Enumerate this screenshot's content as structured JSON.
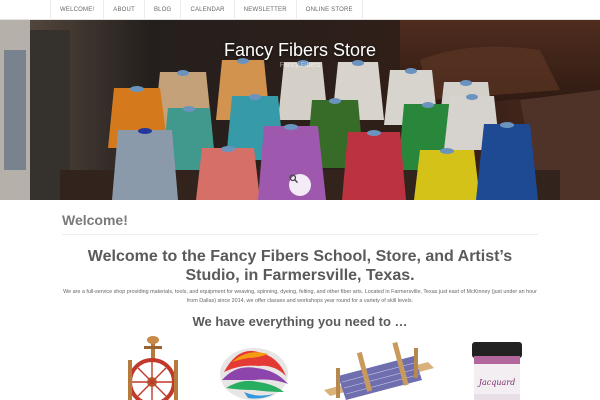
{
  "nav": {
    "items": [
      "WELCOME!",
      "ABOUT",
      "BLOG",
      "CALENDAR",
      "NEWSLETTER",
      "ONLINE STORE"
    ]
  },
  "hero": {
    "title": "Fancy Fibers Store",
    "tagline": "Fancy Fibers"
  },
  "main": {
    "page_title": "Welcome!",
    "heading": "Welcome to the  Fancy Fibers School, Store, and Artist’s Studio, in Farmersville, Texas.",
    "intro": "We are a full-service shop providing materials, tools, and equipment for weaving, spinning, dyeing, felting, and other fiber arts. Located in Farmersville, Texas just east of McKinney (just under an hour from Dallas) since 2014, we offer classes and workshops year round for a variety of skill levels.",
    "subheading": "We have everything you need to …",
    "dye_jar_label": "Jacquard"
  },
  "icons": {
    "search": "search-icon"
  },
  "colors": {
    "nav_text": "#666666",
    "heading": "#5a5a5a"
  }
}
